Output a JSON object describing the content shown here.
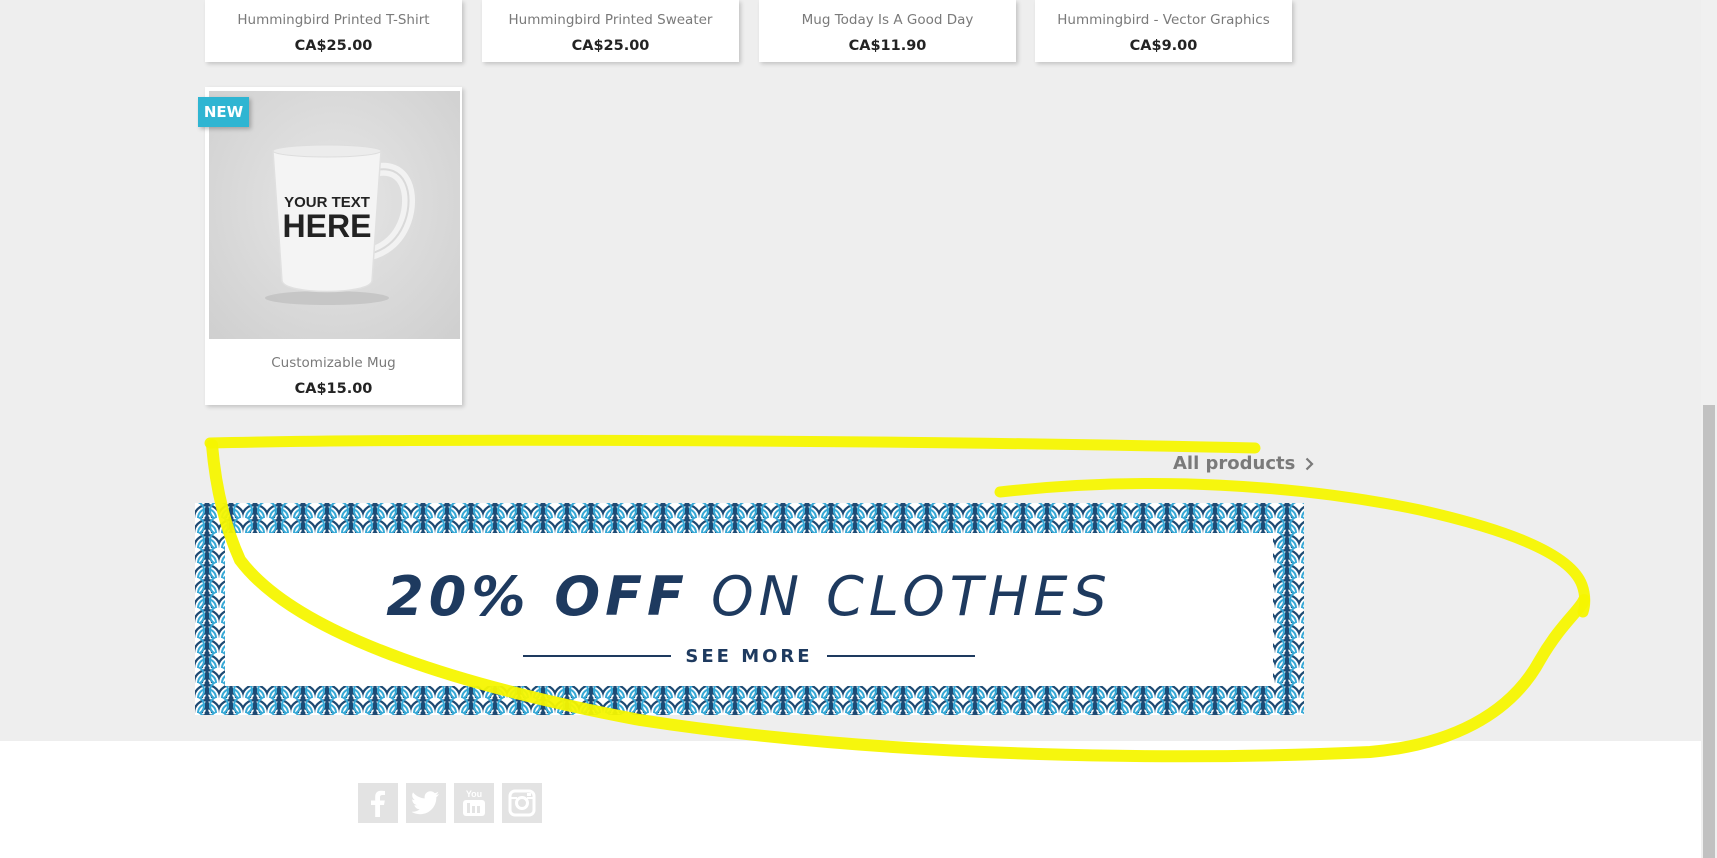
{
  "product_row": [
    {
      "name": "Hummingbird Printed T-Shirt",
      "price": "CA$25.00"
    },
    {
      "name": "Hummingbird Printed Sweater",
      "price": "CA$25.00"
    },
    {
      "name": "Mug Today Is A Good Day",
      "price": "CA$11.90"
    },
    {
      "name": "Hummingbird - Vector Graphics",
      "price": "CA$9.00"
    }
  ],
  "featured_product": {
    "badge": "NEW",
    "name": "Customizable Mug",
    "price": "CA$15.00",
    "mug_text_line1": "YOUR TEXT",
    "mug_text_line2": "HERE"
  },
  "all_products_link": "All products",
  "banner": {
    "title_bold": "20% OFF",
    "title_light": "ON CLOTHES",
    "cta": "SEE MORE"
  },
  "social_icons": [
    "facebook-icon",
    "twitter-icon",
    "youtube-icon",
    "instagram-icon"
  ],
  "colors": {
    "badge": "#2fb5d2",
    "banner_text": "#1e3a5f",
    "highlight": "#f5f500",
    "pattern_dark": "#1e4a73",
    "pattern_light": "#35a8d6"
  }
}
